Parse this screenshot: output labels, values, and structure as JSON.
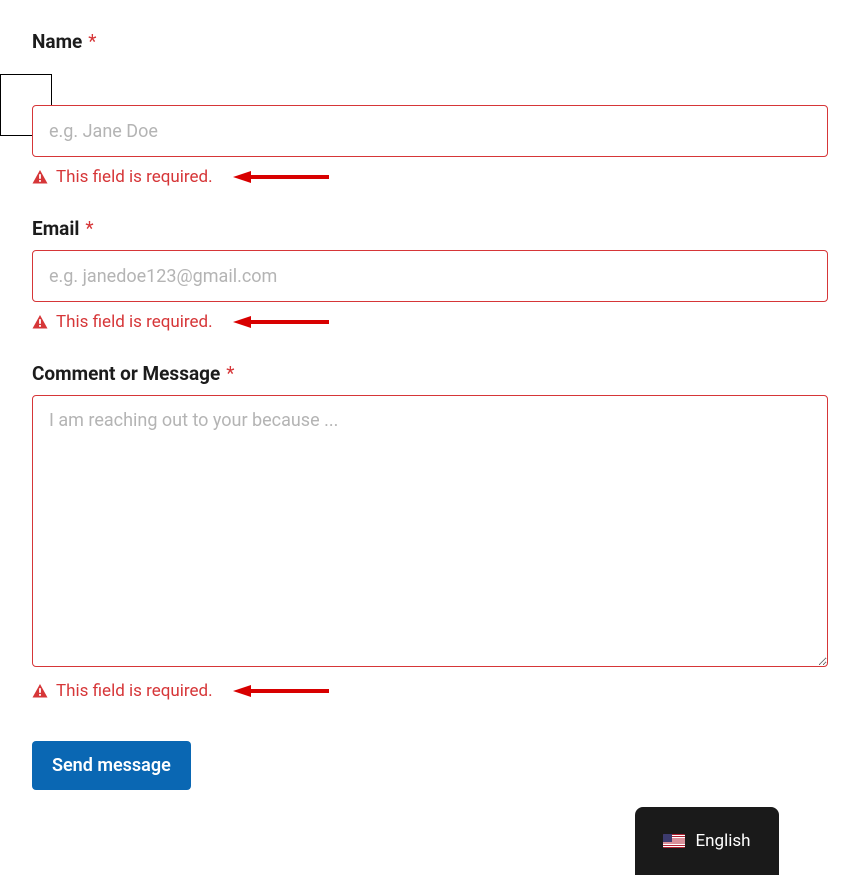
{
  "fields": {
    "name": {
      "label": "Name",
      "required": "*",
      "placeholder": "e.g. Jane Doe",
      "error": "This field is required."
    },
    "email": {
      "label": "Email",
      "required": "*",
      "placeholder": "e.g. janedoe123@gmail.com",
      "error": "This field is required."
    },
    "message": {
      "label": "Comment or Message",
      "required": "*",
      "placeholder": "I am reaching out to your because ...",
      "error": "This field is required."
    }
  },
  "submit_label": "Send message",
  "language": {
    "label": "English",
    "flag": "us"
  },
  "colors": {
    "error": "#d63638",
    "primary": "#0a67b3",
    "widget_bg": "#1a1a1a"
  }
}
